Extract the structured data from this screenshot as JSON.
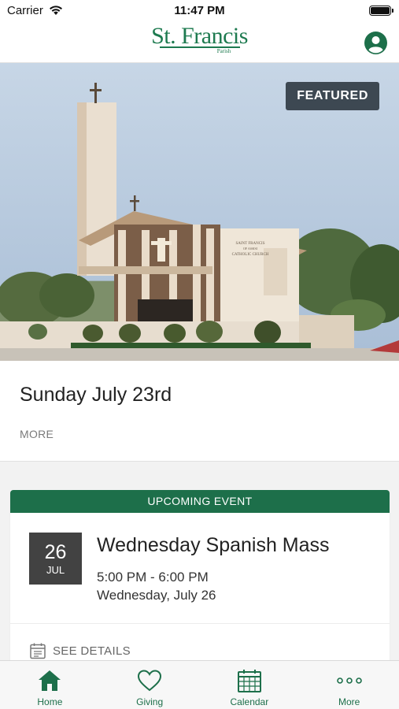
{
  "status_bar": {
    "carrier": "Carrier",
    "time": "11:47 PM"
  },
  "header": {
    "logo_title": "St. Francis",
    "logo_subtitle": "Parish"
  },
  "hero": {
    "badge": "FEATURED",
    "church_sign_line1": "SAINT FRANCIS",
    "church_sign_line2": "OF ASSISI",
    "church_sign_line3": "CATHOLIC CHURCH"
  },
  "featured": {
    "title": "Sunday July 23rd",
    "more_label": "MORE"
  },
  "event": {
    "banner": "UPCOMING EVENT",
    "day": "26",
    "month": "JUL",
    "title": "Wednesday Spanish Mass",
    "time": "5:00 PM - 6:00 PM",
    "date": "Wednesday, July 26",
    "details_label": "SEE DETAILS"
  },
  "tabs": [
    {
      "label": "Home",
      "icon": "home-icon"
    },
    {
      "label": "Giving",
      "icon": "heart-icon"
    },
    {
      "label": "Calendar",
      "icon": "calendar-icon"
    },
    {
      "label": "More",
      "icon": "more-dots-icon"
    }
  ],
  "colors": {
    "brand_green": "#1d6f4a",
    "badge_bg": "#3d4852",
    "date_box": "#424242"
  }
}
